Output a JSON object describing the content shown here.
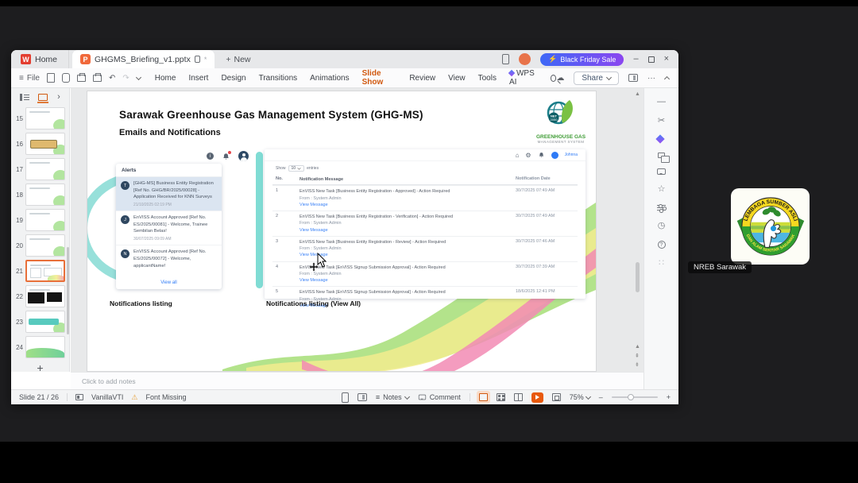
{
  "chrome": {
    "tabs": {
      "w_logo": "W",
      "home_label": "Home",
      "p_logo": "P",
      "doc_title": "GHGMS_Briefing_v1.pptx",
      "unsaved_mark": "*",
      "new_label": "New",
      "promo_label": "Black Friday Sale"
    },
    "menus": {
      "file_label": "File",
      "items": [
        "Home",
        "Insert",
        "Design",
        "Transitions",
        "Animations",
        "Slide Show",
        "Review",
        "View",
        "Tools",
        "WPS AI"
      ],
      "share_label": "Share"
    }
  },
  "sidebar": {
    "slides": [
      "15",
      "16",
      "17",
      "18",
      "19",
      "20",
      "21",
      "22",
      "23",
      "24"
    ],
    "add_label": "+"
  },
  "slide": {
    "title": "Sarawak Greenhouse Gas Management System (GHG-MS)",
    "subtitle": "Emails and Notifications",
    "brand": {
      "badge_line1": "NET",
      "badge_line2": "2050",
      "name_line1": "GREENHOUSE GAS",
      "name_line2": "MANAGEMENT SYSTEM"
    },
    "alerts": {
      "header": "Alerts",
      "view_all": "View all",
      "items": [
        {
          "initial": "T",
          "text": "[GHG-MS] Business Entity Registration [Ref No. GHG/BR/2025/00028] - Application Received for KNN Surveys",
          "time": "21/10/2025 02:19 PM"
        },
        {
          "initial": "J",
          "text": "EnVISS Account Approved [Ref No. ES/2025/00081] - Welcome, Trainee Sembilan Belas!",
          "time": "30/07/2025 09:09 AM"
        },
        {
          "initial": "N",
          "text": "EnVISS Account Approved [Ref No. ES/2025/00072] - Welcome, applicantName!",
          "time": ""
        }
      ]
    },
    "portal": {
      "user": "Johnna",
      "show_label": "Show",
      "page_size": "10",
      "entries_label": "entries",
      "col_no": "No.",
      "col_msg": "Notification Message",
      "col_date": "Notification Date",
      "from_label": "From : System Admin",
      "link_label": "View Message",
      "rows": [
        {
          "no": "1",
          "message": "EnVISS New Task [Business Entity Registration - Approved] - Action Required",
          "date": "30/7/2025 07:49 AM"
        },
        {
          "no": "2",
          "message": "EnVISS New Task [Business Entity Registration - Verification] - Action Required",
          "date": "30/7/2025 07:49 AM"
        },
        {
          "no": "3",
          "message": "EnVISS New Task [Business Entity Registration - Review] - Action Required",
          "date": "30/7/2025 07:46 AM"
        },
        {
          "no": "4",
          "message": "EnVISS New Task [EnVISS Signup Submission Approval] - Action Required",
          "date": "30/7/2025 07:39 AM"
        },
        {
          "no": "5",
          "message": "EnVISS New Task [EnVISS Signup Submission Approval] - Action Required",
          "date": "18/6/2025 12:41 PM"
        }
      ]
    },
    "captions": {
      "left": "Notifications listing",
      "right": "Notifications listing (View All)"
    }
  },
  "notes": {
    "placeholder": "Click to add notes"
  },
  "statusbar": {
    "page_indicator": "Slide 21 / 26",
    "theme_name": "VanillaVTI",
    "font_missing": "Font Missing",
    "notes_label": "Notes",
    "comment_label": "Comment",
    "zoom_value": "75%"
  },
  "participant": {
    "name": "NREB Sarawak",
    "logo_arc_top": "LEMBAGA SUMBER ASLI",
    "logo_arc_bottom": "DAN ALAM SEKITAR SARAWAK"
  },
  "colors": {
    "accent_orange": "#d1590f",
    "promo_from": "#3e68f6",
    "promo_to": "#8b46f0",
    "link_blue": "#2f7bf6",
    "teal": "#5fd0c6"
  }
}
